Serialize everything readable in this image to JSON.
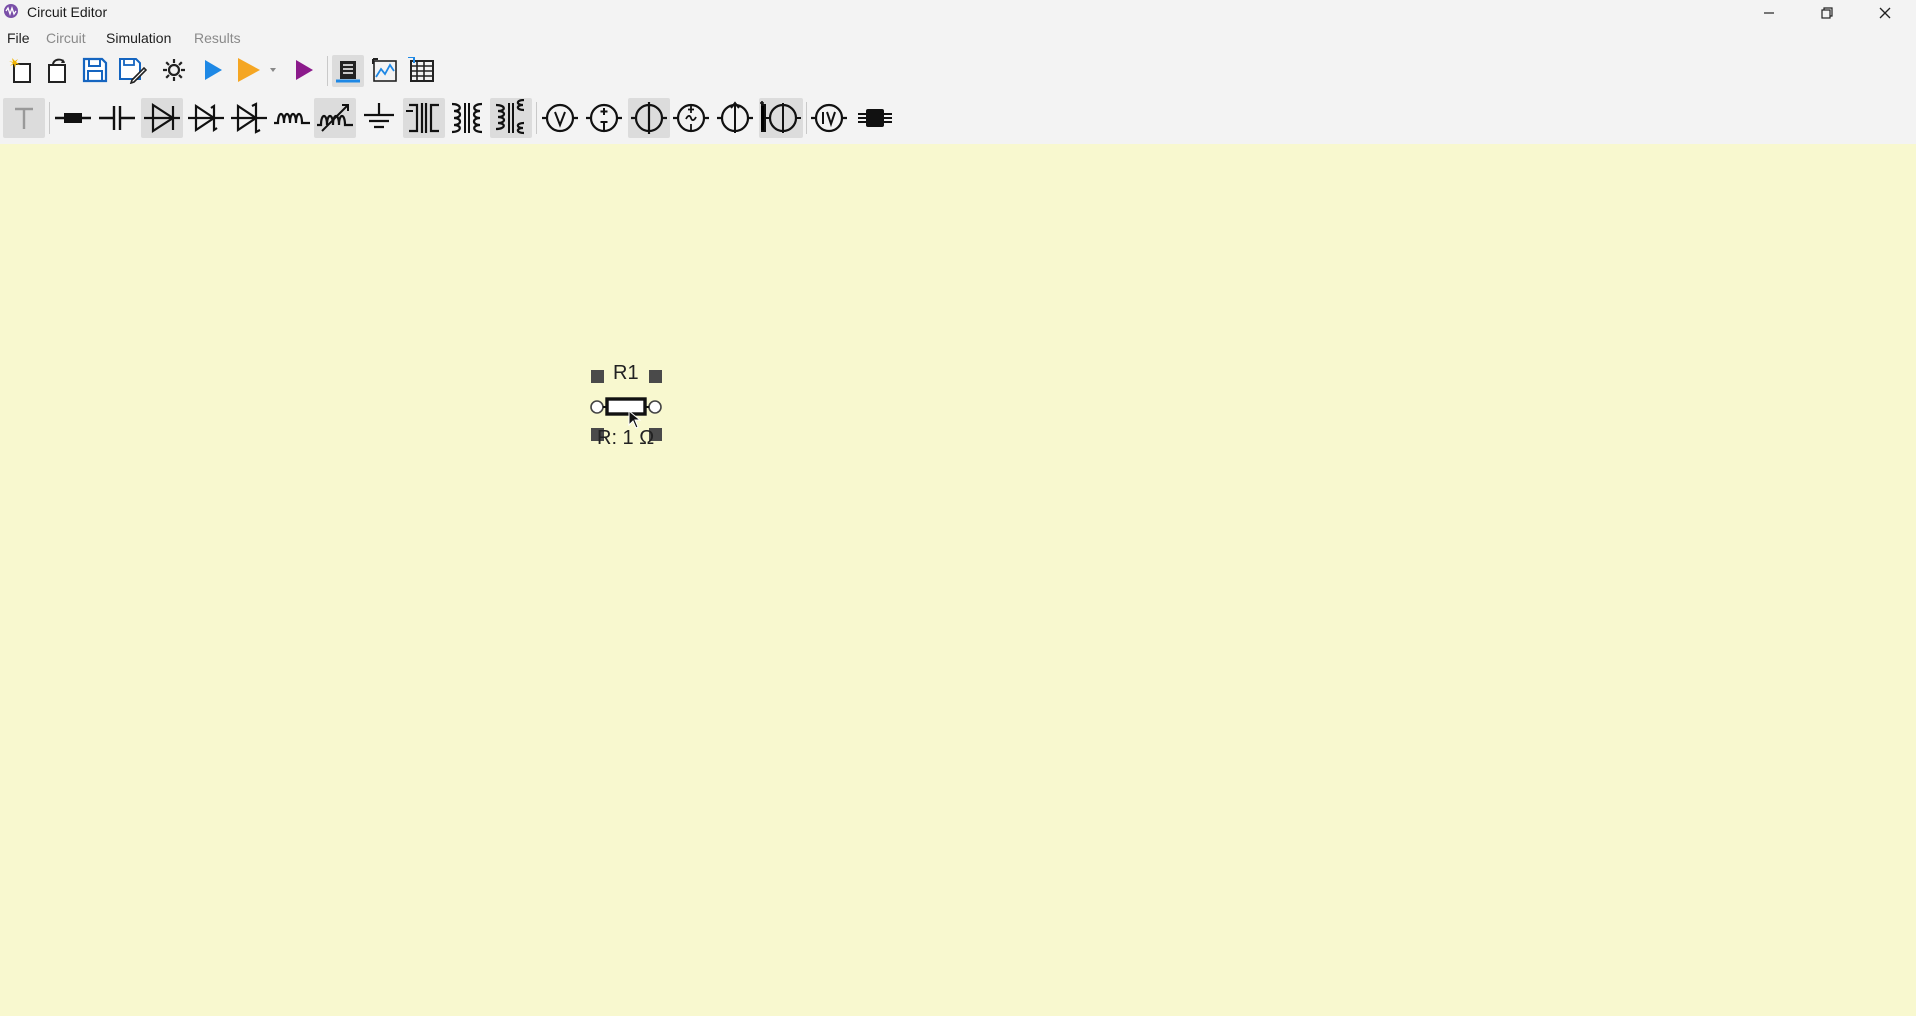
{
  "window": {
    "title": "Circuit Editor",
    "controls": [
      "minimize",
      "maximize",
      "close"
    ]
  },
  "menu": {
    "items": [
      {
        "label": "File",
        "state": "active"
      },
      {
        "label": "Circuit",
        "state": "dim"
      },
      {
        "label": "Simulation",
        "state": "active"
      },
      {
        "label": "Results",
        "state": "dim"
      }
    ]
  },
  "toolbar_main": {
    "buttons": [
      "new-file",
      "open-file",
      "save",
      "save-as",
      "settings",
      "run",
      "run-options",
      "run-step",
      "export-plot",
      "export-zoom",
      "results-table"
    ]
  },
  "toolbar_components": {
    "selected_tool": "text",
    "tools": [
      "text",
      "resistor",
      "capacitor",
      "diode",
      "zener",
      "schottky",
      "inductor",
      "variable-inductor",
      "ground",
      "transformer-1",
      "transformer-2",
      "transformer-3",
      "voltage-source",
      "current-source",
      "ac-voltage-source",
      "dependent-source-1",
      "dependent-source-2",
      "controlled-source",
      "iv-source",
      "chip"
    ]
  },
  "canvas": {
    "background": "#f8f8cf",
    "component": {
      "type": "resistor",
      "name": "R1",
      "value_label": "R: 1 Ω",
      "selected": true
    }
  },
  "colors": {
    "run_blue": "#1e88e5",
    "run_orange": "#f5a623",
    "run_purple": "#8b1a8b"
  }
}
